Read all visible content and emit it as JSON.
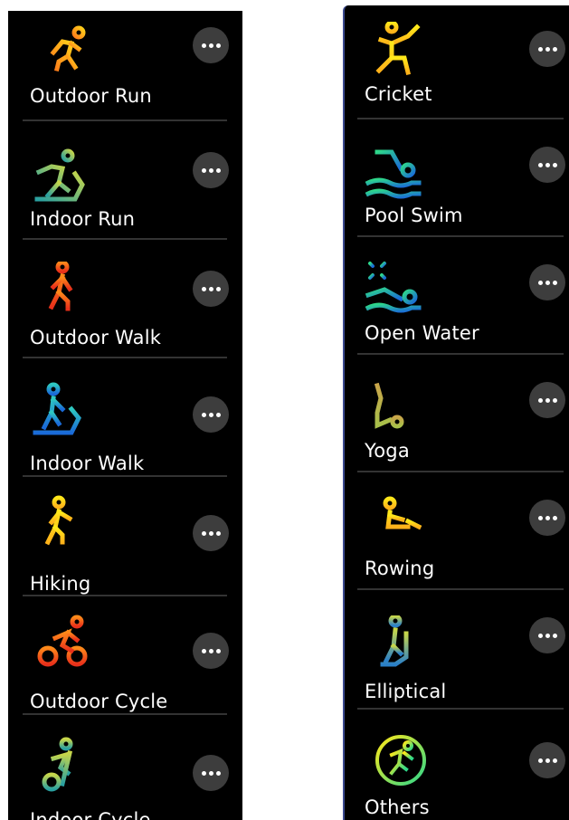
{
  "left_list": {
    "items": [
      {
        "label": "Outdoor Run",
        "icon": "outdoor-run-icon"
      },
      {
        "label": "Indoor Run",
        "icon": "indoor-run-icon"
      },
      {
        "label": "Outdoor Walk",
        "icon": "outdoor-walk-icon"
      },
      {
        "label": "Indoor Walk",
        "icon": "indoor-walk-icon"
      },
      {
        "label": "Hiking",
        "icon": "hiking-icon"
      },
      {
        "label": "Outdoor Cycle",
        "icon": "outdoor-cycle-icon"
      },
      {
        "label": "Indoor Cycle",
        "icon": "indoor-cycle-icon"
      }
    ]
  },
  "right_list": {
    "items": [
      {
        "label": "Cricket",
        "icon": "cricket-icon"
      },
      {
        "label": "Pool Swim",
        "icon": "pool-swim-icon"
      },
      {
        "label": "Open Water",
        "icon": "open-water-icon"
      },
      {
        "label": "Yoga",
        "icon": "yoga-icon"
      },
      {
        "label": "Rowing",
        "icon": "rowing-icon"
      },
      {
        "label": "Elliptical",
        "icon": "elliptical-icon"
      },
      {
        "label": "Others",
        "icon": "others-icon"
      }
    ]
  },
  "colors": {
    "background": "#000000",
    "more_button": "#3d3d3d",
    "divider": "#333333",
    "accent_border": "#3b4a8f"
  }
}
